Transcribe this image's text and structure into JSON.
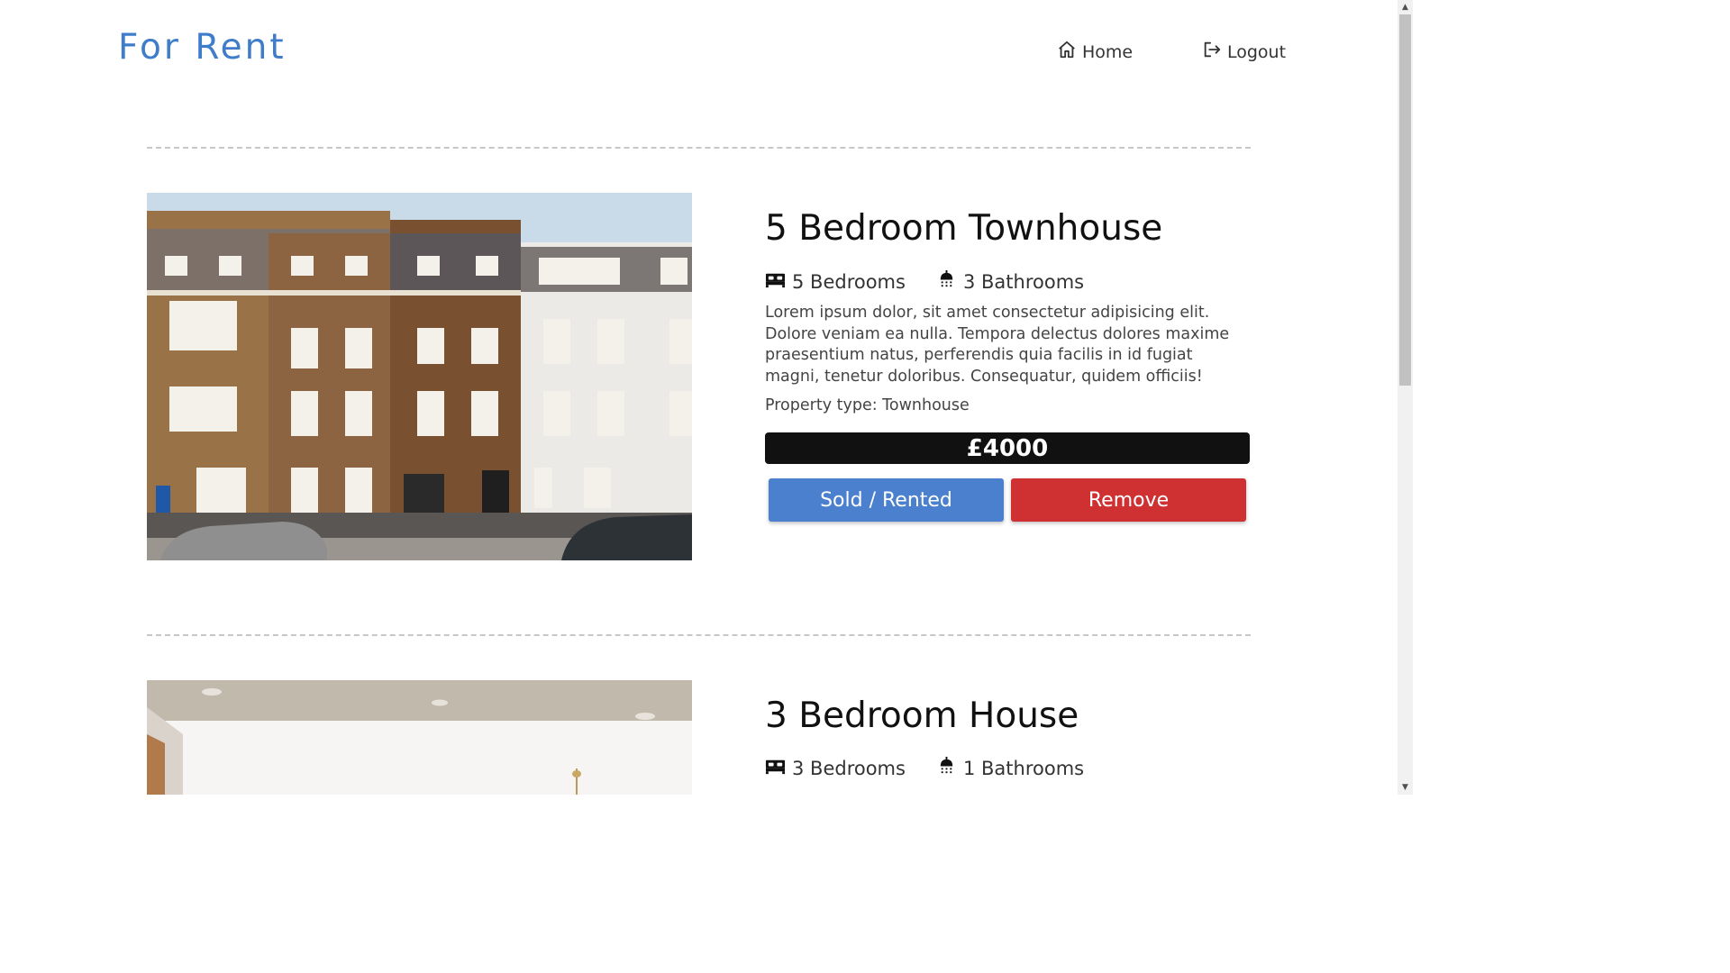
{
  "header": {
    "brand": "For Rent",
    "nav": [
      {
        "label": "Home",
        "icon": "home-icon"
      },
      {
        "label": "Logout",
        "icon": "logout-icon"
      }
    ]
  },
  "listings": [
    {
      "title": "5 Bedroom Townhouse",
      "bedrooms": "5 Bedrooms",
      "bathrooms": "3 Bathrooms",
      "description": "Lorem ipsum dolor, sit amet consectetur adipisicing elit. Dolore veniam ea nulla. Tempora delectus dolores maxime praesentium natus, perferendis quia facilis in id fugiat magni, tenetur doloribus. Consequatur, quidem officiis!",
      "property_type": "Property type: Townhouse",
      "price": "£4000",
      "sold_label": "Sold / Rented",
      "remove_label": "Remove"
    },
    {
      "title": "3 Bedroom House",
      "bedrooms": "3 Bedrooms",
      "bathrooms": "1 Bathrooms"
    }
  ],
  "colors": {
    "brand": "#3f7dcb",
    "price_bg": "#111111",
    "sold_button": "#4a80cd",
    "remove_button": "#cf3133"
  }
}
